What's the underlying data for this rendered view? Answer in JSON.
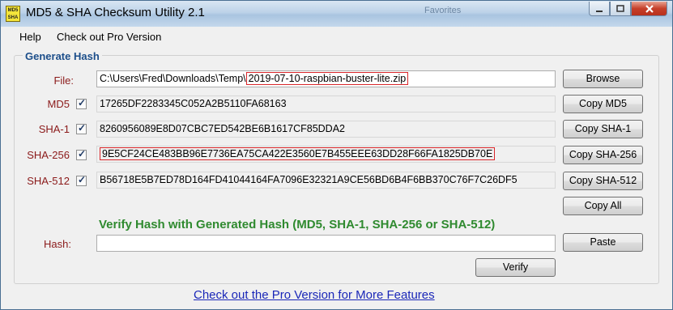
{
  "window": {
    "title": "MD5 & SHA Checksum Utility 2.1",
    "icon_text_top": "MD5",
    "icon_text_bottom": "SHA",
    "background_ghost_text": "Favorites",
    "caption_icons": [
      "minimize-icon",
      "maximize-icon",
      "close-icon"
    ]
  },
  "menu": {
    "help": "Help",
    "pro": "Check out Pro Version"
  },
  "group": {
    "title": "Generate Hash"
  },
  "file": {
    "label": "File:",
    "path_prefix": "C:\\Users\\Fred\\Downloads\\Temp\\",
    "filename": "2019-07-10-raspbian-buster-lite.zip",
    "browse_label": "Browse"
  },
  "hashes": {
    "md5": {
      "label": "MD5",
      "checked": true,
      "value": "17265DF2283345C052A2B5110FA68163",
      "button": "Copy MD5"
    },
    "sha1": {
      "label": "SHA-1",
      "checked": true,
      "value": "8260956089E8D07CBC7ED542BE6B1617CF85DDA2",
      "button": "Copy SHA-1"
    },
    "sha256": {
      "label": "SHA-256",
      "checked": true,
      "value": "9E5CF24CE483BB96E7736EA75CA422E3560E7B455EEE63DD28F66FA1825DB70E",
      "button": "Copy SHA-256"
    },
    "sha512": {
      "label": "SHA-512",
      "checked": true,
      "value": "B56718E5B7ED78D164FD41044164FA7096E32321A9CE56BD6B4F6BB370C76F7C26DF5",
      "button": "Copy SHA-512"
    }
  },
  "copy_all_label": "Copy All",
  "verify": {
    "title": "Verify Hash with Generated Hash (MD5, SHA-1, SHA-256 or SHA-512)",
    "hash_label": "Hash:",
    "hash_value": "",
    "paste_label": "Paste",
    "verify_label": "Verify"
  },
  "footer_link": "Check out the Pro Version for More Features",
  "colors": {
    "label_red": "#8b1a1a",
    "group_title_blue": "#1c4e8a",
    "verify_green": "#2f8a2f",
    "link_blue": "#1a27b8",
    "highlight_red": "#d9262a"
  }
}
